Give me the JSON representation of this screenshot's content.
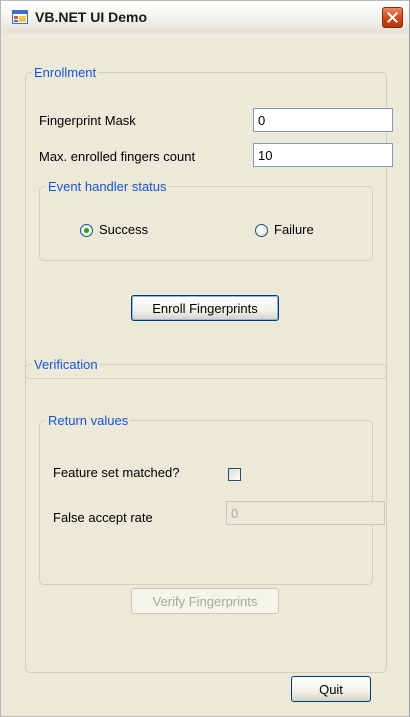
{
  "window": {
    "title": "VB.NET UI Demo"
  },
  "enrollment": {
    "group_title": "Enrollment",
    "fingerprint_mask_label": "Fingerprint Mask",
    "fingerprint_mask_value": "0",
    "max_enrolled_label": "Max. enrolled fingers count",
    "max_enrolled_value": "10",
    "event_status": {
      "group_title": "Event handler status",
      "success_label": "Success",
      "failure_label": "Failure",
      "selected": "Success"
    },
    "enroll_button_label": "Enroll Fingerprints"
  },
  "verification": {
    "group_title": "Verification",
    "return_values": {
      "group_title": "Return values",
      "feature_set_label": "Feature set matched?",
      "feature_set_checked": false,
      "far_label": "False accept rate",
      "far_value": "0"
    },
    "verify_button_label": "Verify Fingerprints"
  },
  "quit_button_label": "Quit",
  "colors": {
    "group_title": "#1755d6",
    "form_background": "#ece9d8",
    "close_button": "#d24a1e",
    "radio_selected": "#24a324"
  },
  "icons": {
    "app": "window-app-icon",
    "close": "close-icon"
  }
}
